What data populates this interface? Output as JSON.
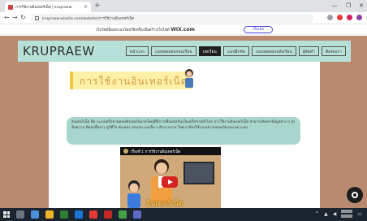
{
  "browser": {
    "tab_title": "การใช้งานอินเทอร์เน็ต | krupraew",
    "tab_close": "×",
    "new_tab": "+",
    "window_controls": [
      "—",
      "❐",
      "✕"
    ],
    "url": "krupraew.wixsite.com/website/การใช้งานอินเทอร์เน็ต"
  },
  "wix_banner": {
    "message": "เว็บไซต์นี้ออกแบบโดยใช้เครื่องมือสร้างเว็บไซต์ ",
    "brand": "WIX.com",
    "cta": "เริ่มเลย"
  },
  "site": {
    "logo": "KRUPRAEW",
    "menu": [
      {
        "label": "หน้าแรก",
        "active": false
      },
      {
        "label": "แบบทดสอบก่อนเรียน",
        "active": false
      },
      {
        "label": "บทเรียน",
        "active": true
      },
      {
        "label": "แบบฝึกหัด",
        "active": false
      },
      {
        "label": "แบบทดสอบหลังเรียน",
        "active": false
      },
      {
        "label": "ผู้จัดทำ",
        "active": false
      },
      {
        "label": "ติดต่อเรา",
        "active": false
      }
    ]
  },
  "main": {
    "title": "การใช้งานอินเทอร์เน็ต",
    "paragraph": "อินเทอร์เน็ต คือ ระบบเครือข่ายคอมพิวเตอร์ขนาดใหญ่ที่มีการเชื่อมต่อกันเป็นเครือข่ายทั่วโลก การใช้งานอินเทอร์เน็ต สามารถค้นหาข้อมูลต่าง ๆ ส่งข้อความ ติดต่อสื่อสาร ดูวิดีโอ ฟังเพลง เล่นเกม และอื่น ๆ อีกมากมาย โดยเราต้องใช้งานอย่างปลอดภัยและเหมาะสม",
    "video": {
      "title": "เรื่องที่ 1 การใช้งานอินเทอร์เน็ต",
      "caption": "อินเทอร์เน็ต"
    }
  },
  "colors": {
    "page_bg": "#b98a70",
    "header_bg": "#b7e1d8",
    "title_bg": "#fff0a8",
    "title_text": "#d29a3a",
    "bubble_bg": "#a8d6cc",
    "play_red": "#d42323"
  },
  "icons": [
    "back-icon",
    "forward-icon",
    "reload-icon",
    "lock-icon",
    "chat-icon",
    "play-icon",
    "windows-start-icon"
  ]
}
